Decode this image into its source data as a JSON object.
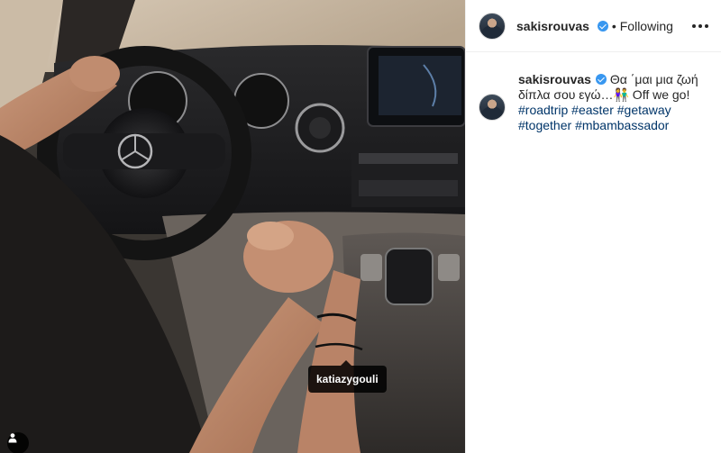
{
  "post": {
    "username": "sakisrouvas",
    "header_status": "Following",
    "separator": "•",
    "caption_text": "Θα ΄μαι μια ζωή δίπλα σου εγώ…👫 Off we go!",
    "hashtags": [
      "#roadtrip",
      "#easter",
      "#getaway",
      "#together",
      "#mbambassador"
    ]
  },
  "photo": {
    "tagged_user": "katiazygouli"
  },
  "icons": {
    "verified": "verified-badge-icon",
    "more": "more-options-icon",
    "user_tags": "user-tag-icon"
  },
  "colors": {
    "link": "#003569",
    "verified": "#3897f0",
    "text": "#262626",
    "divider": "#efefef"
  }
}
